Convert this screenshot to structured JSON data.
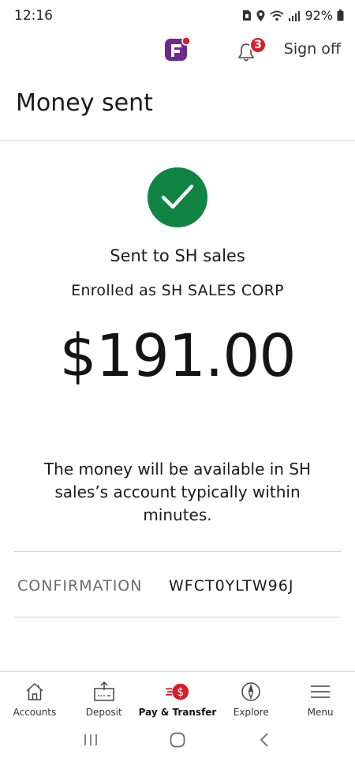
{
  "status_bar": {
    "time": "12:16",
    "battery": "92%"
  },
  "header": {
    "notification_count": "3",
    "sign_off_label": "Sign off",
    "brand_color": "#6d2a8e",
    "badge_color": "#d71e28"
  },
  "page": {
    "title": "Money sent"
  },
  "result": {
    "success_color": "#0f8443",
    "sent_to": "Sent to SH sales",
    "enrolled_as": "Enrolled as SH SALES CORP",
    "amount": "$191.00",
    "availability_message": "The money will be available in SH sales’s account typically within minutes.",
    "confirmation_label": "CONFIRMATION",
    "confirmation_value": "WFCT0YLTW96J"
  },
  "tab_bar": {
    "active_color": "#d71e28",
    "tabs": [
      {
        "label": "Accounts",
        "icon": "home-icon"
      },
      {
        "label": "Deposit",
        "icon": "deposit-icon"
      },
      {
        "label": "Pay & Transfer",
        "icon": "pay-transfer-icon",
        "active": true
      },
      {
        "label": "Explore",
        "icon": "compass-icon"
      },
      {
        "label": "Menu",
        "icon": "menu-icon"
      }
    ]
  }
}
